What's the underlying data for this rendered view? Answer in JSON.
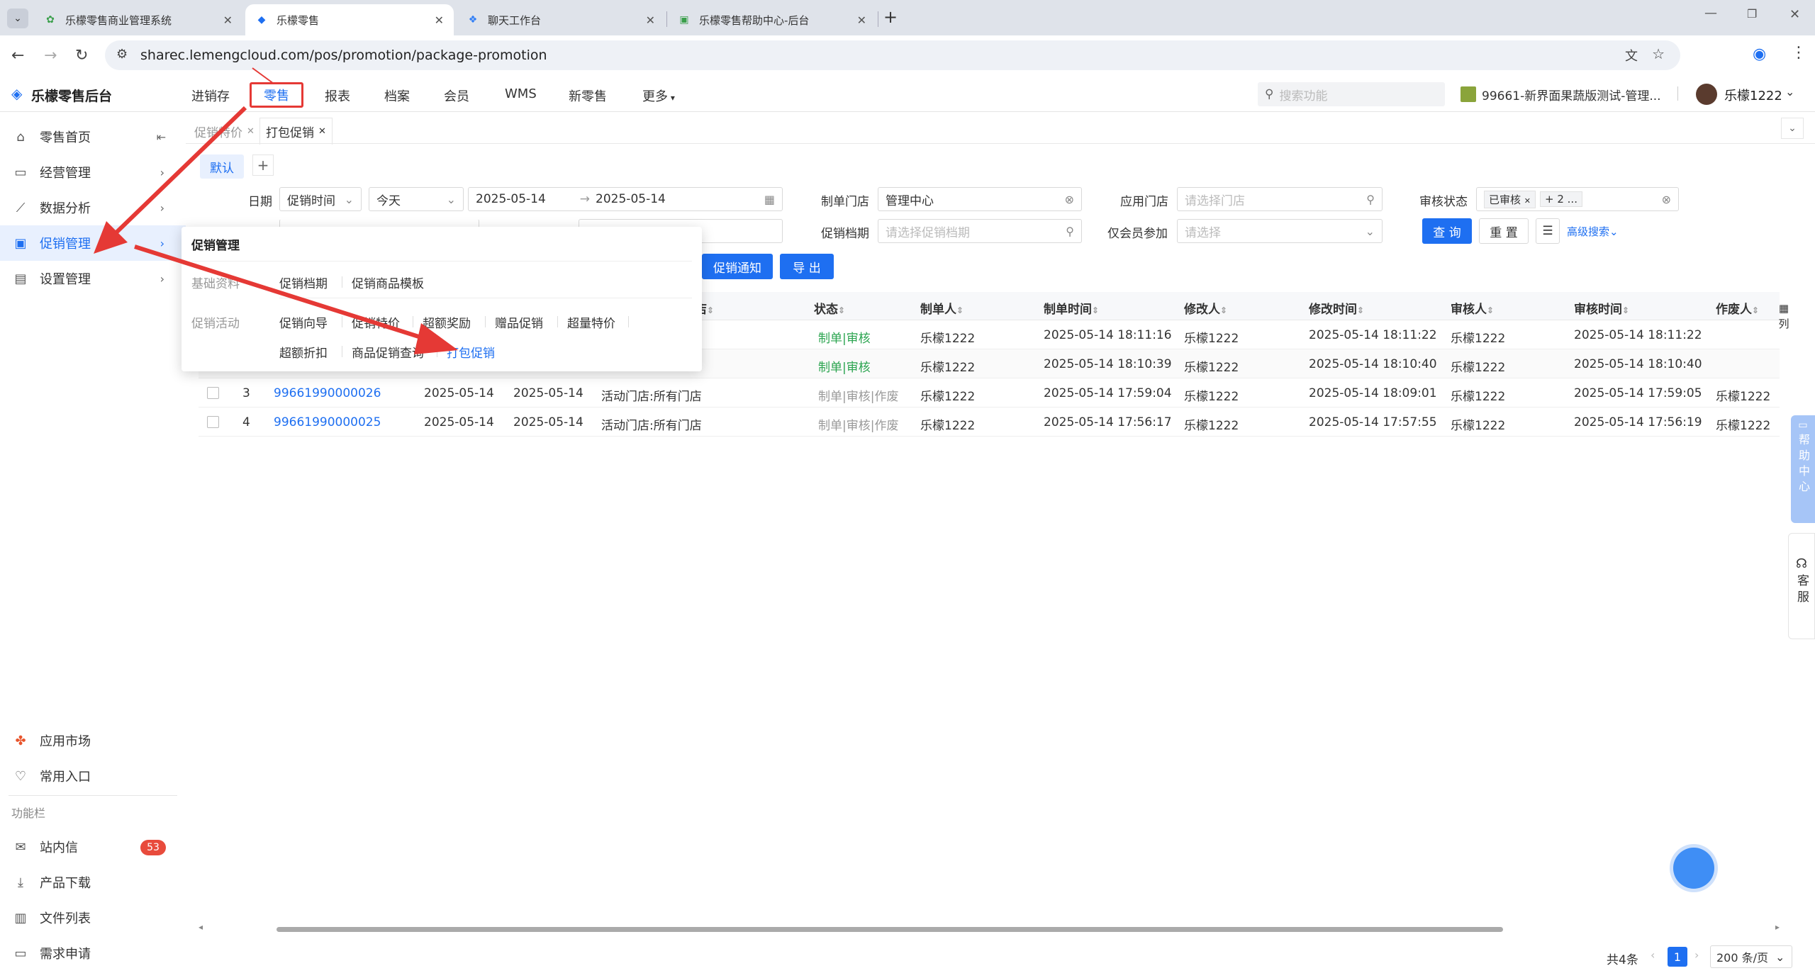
{
  "browser": {
    "tabs": [
      {
        "title": "乐檬零售商业管理系统"
      },
      {
        "title": "乐檬零售"
      },
      {
        "title": "聊天工作台"
      },
      {
        "title": "乐檬零售帮助中心-后台"
      }
    ],
    "url": "sharec.lemengcloud.com/pos/promotion/package-promotion"
  },
  "header": {
    "logo": "乐檬零售后台",
    "nav": [
      "进销存",
      "零售",
      "报表",
      "档案",
      "会员",
      "WMS",
      "新零售",
      "更多"
    ],
    "search_placeholder": "搜索功能",
    "store": "99661-新界面果蔬版测试-管理...",
    "user": "乐檬1222"
  },
  "sidebar": {
    "items": [
      "零售首页",
      "经营管理",
      "数据分析",
      "促销管理",
      "设置管理"
    ],
    "bottom": [
      "应用市场",
      "常用入口"
    ],
    "section": "功能栏",
    "tools": [
      "站内信",
      "产品下载",
      "文件列表",
      "需求申请"
    ],
    "badge": "53"
  },
  "page_tabs": [
    "促销特价",
    "打包促销"
  ],
  "view_tab": "默认",
  "filters": {
    "date_label": "日期",
    "date_type": "促销时间",
    "date_range": "今天",
    "date_from": "2025-05-14",
    "date_to": "2025-05-14",
    "make_store_label": "制单门店",
    "make_store_value": "管理中心",
    "apply_store_label": "应用门店",
    "apply_store_placeholder": "请选择门店",
    "audit_label": "审核状态",
    "audit_tag": "已审核",
    "audit_more": "+ 2 ...",
    "schedule_label": "促销档期",
    "schedule_placeholder": "请选择促销档期",
    "member_label": "仅会员参加",
    "member_placeholder": "请选择",
    "query": "查 询",
    "reset": "重 置",
    "advanced": "高级搜索"
  },
  "actions": [
    "促销通知",
    "导 出"
  ],
  "table": {
    "headers": [
      "状态",
      "制单人",
      "制单时间",
      "修改人",
      "修改时间",
      "审核人",
      "审核时间",
      "作废人"
    ],
    "partial_header_suffix": "店",
    "col_setting": "列",
    "rows": [
      {
        "status": "制单|审核",
        "maker": "乐檬1222",
        "make_time": "2025-05-14 18:11:16",
        "modifier": "乐檬1222",
        "modify_time": "2025-05-14 18:11:22",
        "auditor": "乐檬1222",
        "audit_time": "2025-05-14 18:11:22",
        "voider": ""
      },
      {
        "status": "制单|审核",
        "maker": "乐檬1222",
        "make_time": "2025-05-14 18:10:39",
        "modifier": "乐檬1222",
        "modify_time": "2025-05-14 18:10:40",
        "auditor": "乐檬1222",
        "audit_time": "2025-05-14 18:10:40",
        "voider": ""
      },
      {
        "idx": "3",
        "code": "99661990000026",
        "start": "2025-05-14",
        "end": "2025-05-14",
        "scope": "活动门店:所有门店",
        "status": "制单|审核|作废",
        "maker": "乐檬1222",
        "make_time": "2025-05-14 17:59:04",
        "modifier": "乐檬1222",
        "modify_time": "2025-05-14 18:09:01",
        "auditor": "乐檬1222",
        "audit_time": "2025-05-14 17:59:05",
        "voider": "乐檬1222"
      },
      {
        "idx": "4",
        "code": "99661990000025",
        "start": "2025-05-14",
        "end": "2025-05-14",
        "scope": "活动门店:所有门店",
        "status": "制单|审核|作废",
        "maker": "乐檬1222",
        "make_time": "2025-05-14 17:56:17",
        "modifier": "乐檬1222",
        "modify_time": "2025-05-14 17:57:55",
        "auditor": "乐檬1222",
        "audit_time": "2025-05-14 17:56:19",
        "voider": "乐檬1222"
      }
    ]
  },
  "popup": {
    "title": "促销管理",
    "basic_label": "基础资料",
    "basic_items": [
      "促销档期",
      "促销商品模板"
    ],
    "activity_label": "促销活动",
    "activity_row1": [
      "促销向导",
      "促销特价",
      "超额奖励",
      "赠品促销",
      "超量特价"
    ],
    "activity_row2": [
      "超额折扣",
      "商品促销查询",
      "打包促销"
    ]
  },
  "pagination": {
    "total": "共4条",
    "page": "1",
    "page_size": "200 条/页"
  },
  "float": {
    "help": "帮助中心",
    "service": "客服"
  }
}
